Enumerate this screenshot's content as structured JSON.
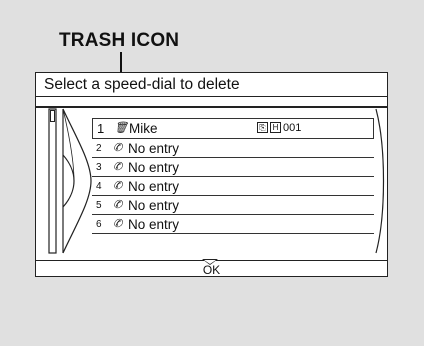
{
  "callout": {
    "label": "TRASH ICON"
  },
  "screen": {
    "title": "Select a speed-dial to delete",
    "rows": [
      {
        "num": "1",
        "icon": "trash-icon",
        "glyph": "🗑",
        "name": "Mike",
        "badges": [
          "⎘",
          "H"
        ],
        "number": "001",
        "selected": true
      },
      {
        "num": "2",
        "icon": "phone-icon",
        "glyph": "✆",
        "name": "No entry"
      },
      {
        "num": "3",
        "icon": "phone-icon",
        "glyph": "✆",
        "name": "No entry"
      },
      {
        "num": "4",
        "icon": "phone-icon",
        "glyph": "✆",
        "name": "No entry"
      },
      {
        "num": "5",
        "icon": "phone-icon",
        "glyph": "✆",
        "name": "No entry"
      },
      {
        "num": "6",
        "icon": "phone-icon",
        "glyph": "✆",
        "name": "No entry"
      }
    ],
    "footer_label": "OK"
  }
}
